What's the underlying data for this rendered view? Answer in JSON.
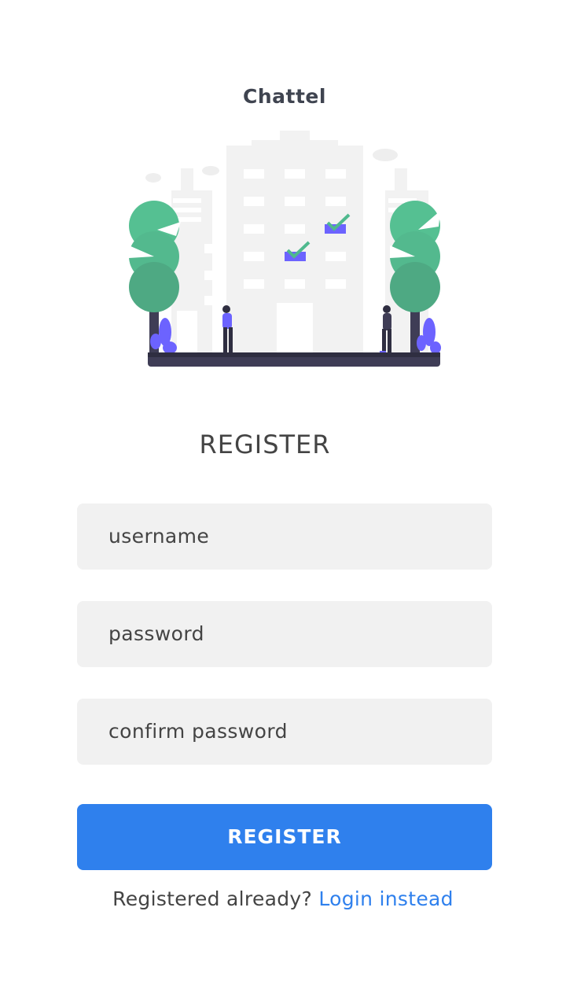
{
  "app": {
    "title": "Chattel"
  },
  "illustration": {
    "icon": "city-registration-illustration",
    "colors": {
      "building": "#f0f0f0",
      "tree": "#4fb98e",
      "accent": "#6c63ff",
      "ground": "#3f3d56"
    }
  },
  "form": {
    "heading": "REGISTER",
    "username": {
      "placeholder": "username",
      "value": ""
    },
    "password": {
      "placeholder": "password",
      "value": ""
    },
    "confirm_password": {
      "placeholder": "confirm password",
      "value": ""
    },
    "submit_label": "REGISTER"
  },
  "footer": {
    "prompt": "Registered already?",
    "link_label": "Login instead"
  },
  "colors": {
    "primary": "#2f80ed",
    "field_bg": "#f1f1f1",
    "text": "#444444"
  }
}
